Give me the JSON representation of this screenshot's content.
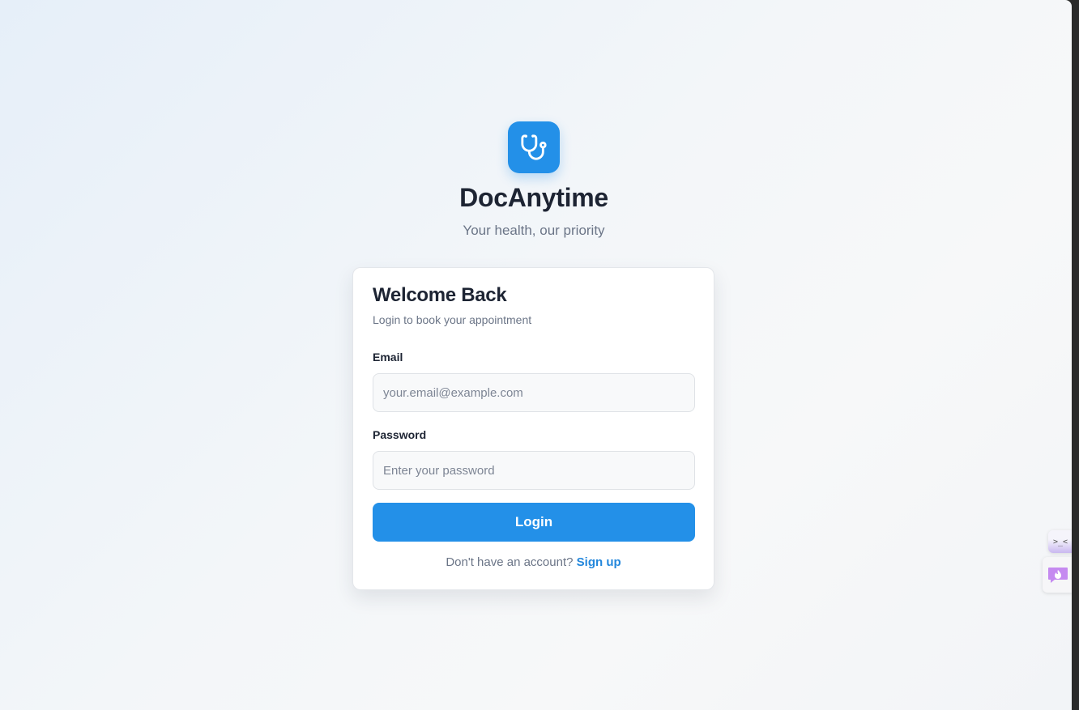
{
  "brand": {
    "name": "DocAnytime",
    "tagline": "Your health, our priority",
    "accent": "#2390e8"
  },
  "login_card": {
    "title": "Welcome Back",
    "subtitle": "Login to book your appointment",
    "email": {
      "label": "Email",
      "placeholder": "your.email@example.com",
      "value": ""
    },
    "password": {
      "label": "Password",
      "placeholder": "Enter your password",
      "value": ""
    },
    "submit_label": "Login",
    "signup_prompt": "Don't have an account?",
    "signup_link": "Sign up"
  },
  "extensions": {
    "widget1_glyph": ">_<"
  },
  "icons": {
    "logo": "stethoscope-icon",
    "widget2": "chat-flame-icon"
  }
}
